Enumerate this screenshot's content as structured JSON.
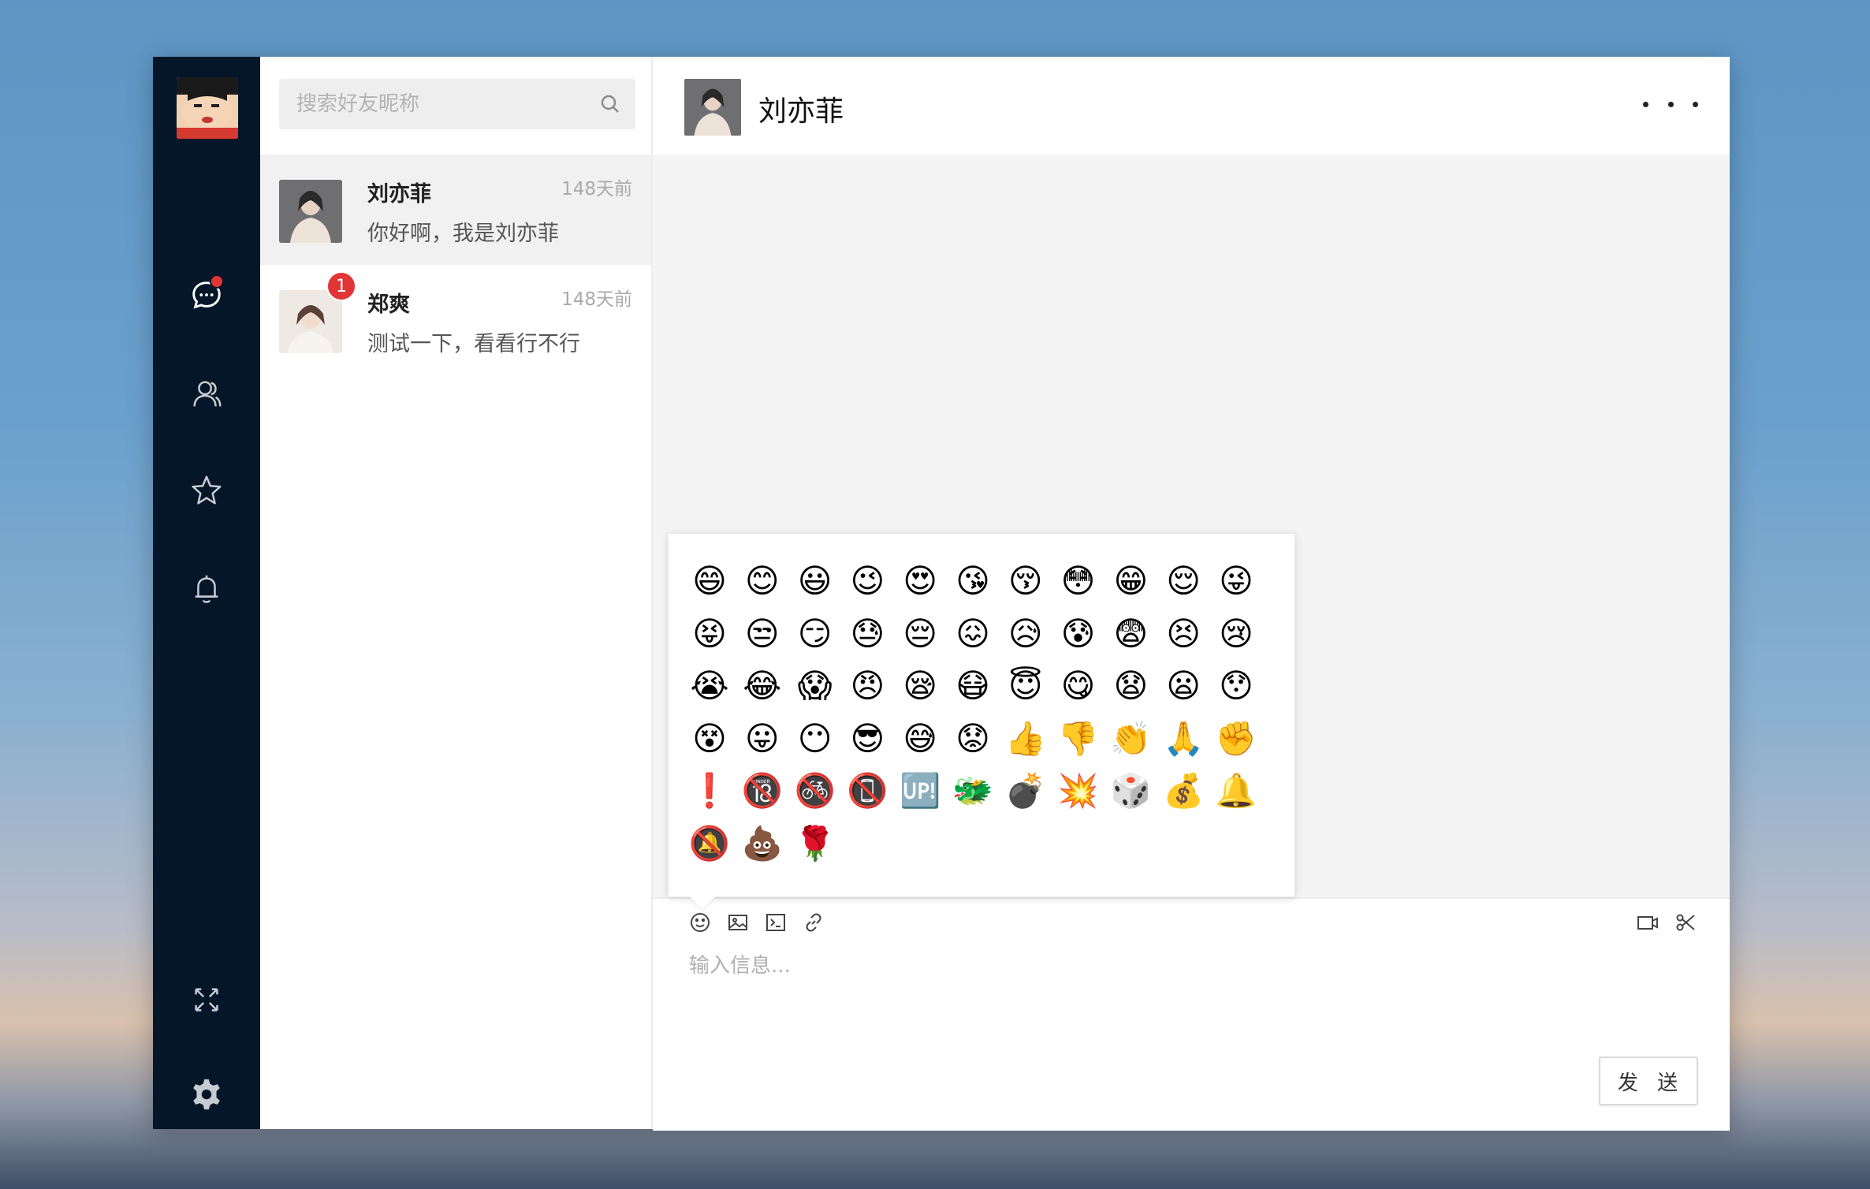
{
  "search": {
    "placeholder": "搜索好友昵称"
  },
  "contacts": [
    {
      "name": "刘亦菲",
      "time": "148天前",
      "preview": "你好啊，我是刘亦菲",
      "unread": ""
    },
    {
      "name": "郑爽",
      "time": "148天前",
      "preview": "测试一下，看看行不行",
      "unread": "1"
    }
  ],
  "chat": {
    "title": "刘亦菲"
  },
  "input": {
    "placeholder": "输入信息...",
    "send_label": "发 送"
  },
  "emojis": [
    "😄",
    "😊",
    "😃",
    "😉",
    "😍",
    "😘",
    "😚",
    "😳",
    "😁",
    "😌",
    "😜",
    "😝",
    "😒",
    "😏",
    "😓",
    "😔",
    "😖",
    "😥",
    "😰",
    "😨",
    "😣",
    "😢",
    "😭",
    "😂",
    "😱",
    "😠",
    "😪",
    "😷",
    "😇",
    "😋",
    "😧",
    "😦",
    "😯",
    "😵",
    "😛",
    "😶",
    "😎",
    "😅",
    "😟",
    "👍",
    "👎",
    "👏",
    "🙏",
    "✊",
    "❗",
    "🔞",
    "🚳",
    "📵",
    "🆙",
    "🐲",
    "💣",
    "💥",
    "🎲",
    "💰",
    "🔔",
    "🔕",
    "💩",
    "🌹"
  ],
  "colors": {
    "sidebar": "#061629",
    "badge": "#e23535",
    "chat_bg": "#f4f4f4"
  }
}
